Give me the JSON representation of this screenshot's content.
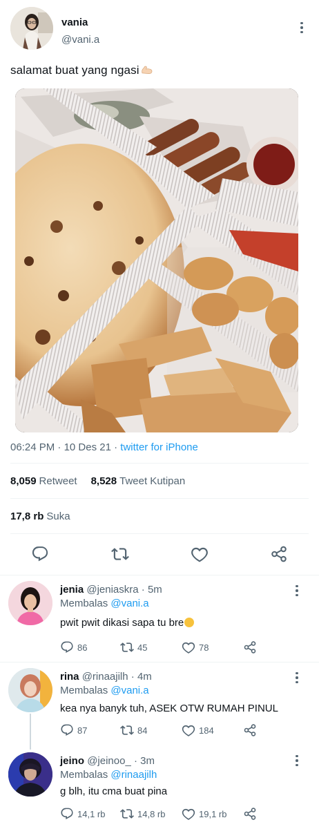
{
  "tweet": {
    "author_name": "vania",
    "author_handle": "@vani.a",
    "text": "salamat buat yang ngasi",
    "time": "06:24 PM",
    "date": "10 Des 21",
    "separator": "·",
    "client": "twitter for iPhone",
    "retweets": "8,059",
    "retweets_label": "Retweet",
    "quotes": "8,528",
    "quotes_label": "Tweet Kutipan",
    "likes": "17,8 rb",
    "likes_label": "Suka"
  },
  "replies": [
    {
      "name": "jenia",
      "handle": "@jeniaskra",
      "age": "· 5m",
      "replying_label": "Membalas",
      "replying_to": "@vani.a",
      "text": "pwit pwit dikasi sapa tu bre",
      "reply_count": "86",
      "retweet_count": "45",
      "like_count": "78"
    },
    {
      "name": "rina",
      "handle": "@rinaajilh",
      "age": "· 4m",
      "replying_label": "Membalas",
      "replying_to": "@vani.a",
      "text": "kea nya banyk tuh, ASEK OTW RUMAH PINUL",
      "reply_count": "87",
      "retweet_count": "84",
      "like_count": "184"
    },
    {
      "name": "jeino",
      "handle": "@jeinoo_",
      "age": "· 3m",
      "replying_label": "Membalas",
      "replying_to": "@rinaajilh",
      "text": "g blh, itu cma buat pina",
      "reply_count": "14,1 rb",
      "retweet_count": "14,8 rb",
      "like_count": "19,1 rb"
    }
  ],
  "colors": {
    "link": "#1d9bf0",
    "secondary_text": "#536471",
    "divider": "#eff3f4"
  },
  "icons": [
    "more-icon",
    "reply-icon",
    "retweet-icon",
    "like-icon",
    "share-icon",
    "flexed-biceps-emoji",
    "face-emoji"
  ]
}
